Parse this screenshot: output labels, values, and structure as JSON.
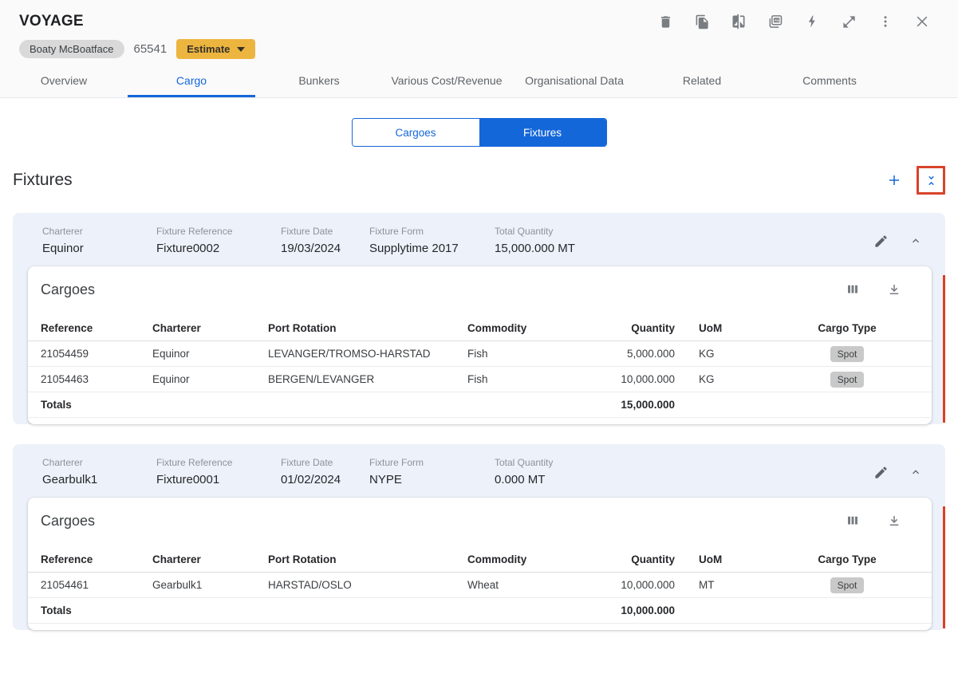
{
  "header": {
    "title": "VOYAGE",
    "vessel_name": "Boaty McBoatface",
    "voyage_number": "65541",
    "estimate_label": "Estimate",
    "tabs": [
      {
        "label": "Overview"
      },
      {
        "label": "Cargo"
      },
      {
        "label": "Bunkers"
      },
      {
        "label": "Various Cost/Revenue"
      },
      {
        "label": "Organisational Data"
      },
      {
        "label": "Related"
      },
      {
        "label": "Comments"
      }
    ],
    "active_tab": "Cargo"
  },
  "view_toggle": {
    "cargoes_label": "Cargoes",
    "fixtures_label": "Fixtures",
    "selected": "Fixtures"
  },
  "fixtures_section": {
    "title": "Fixtures",
    "cards": [
      {
        "fields": [
          {
            "label": "Charterer",
            "value": "Equinor"
          },
          {
            "label": "Fixture Reference",
            "value": "Fixture0002"
          },
          {
            "label": "Fixture Date",
            "value": "19/03/2024"
          },
          {
            "label": "Fixture Form",
            "value": "Supplytime 2017"
          },
          {
            "label": "Total Quantity",
            "value": "15,000.000 MT"
          }
        ],
        "cargoes": {
          "title": "Cargoes",
          "columns": {
            "reference": "Reference",
            "charterer": "Charterer",
            "port_rotation": "Port Rotation",
            "commodity": "Commodity",
            "quantity": "Quantity",
            "uom": "UoM",
            "cargo_type": "Cargo Type"
          },
          "rows": [
            {
              "reference": "21054459",
              "charterer": "Equinor",
              "port_rotation": "LEVANGER/TROMSO-HARSTAD",
              "commodity": "Fish",
              "quantity": "5,000.000",
              "uom": "KG",
              "cargo_type": "Spot"
            },
            {
              "reference": "21054463",
              "charterer": "Equinor",
              "port_rotation": "BERGEN/LEVANGER",
              "commodity": "Fish",
              "quantity": "10,000.000",
              "uom": "KG",
              "cargo_type": "Spot"
            }
          ],
          "totals_label": "Totals",
          "total_quantity": "15,000.000"
        }
      },
      {
        "fields": [
          {
            "label": "Charterer",
            "value": "Gearbulk1"
          },
          {
            "label": "Fixture Reference",
            "value": "Fixture0001"
          },
          {
            "label": "Fixture Date",
            "value": "01/02/2024"
          },
          {
            "label": "Fixture Form",
            "value": "NYPE"
          },
          {
            "label": "Total Quantity",
            "value": "0.000 MT"
          }
        ],
        "cargoes": {
          "title": "Cargoes",
          "columns": {
            "reference": "Reference",
            "charterer": "Charterer",
            "port_rotation": "Port Rotation",
            "commodity": "Commodity",
            "quantity": "Quantity",
            "uom": "UoM",
            "cargo_type": "Cargo Type"
          },
          "rows": [
            {
              "reference": "21054461",
              "charterer": "Gearbulk1",
              "port_rotation": "HARSTAD/OSLO",
              "commodity": "Wheat",
              "quantity": "10,000.000",
              "uom": "MT",
              "cargo_type": "Spot"
            }
          ],
          "totals_label": "Totals",
          "total_quantity": "10,000.000"
        }
      }
    ]
  },
  "colors": {
    "accent_blue": "#1467d9",
    "estimate_amber": "#ecb53f",
    "highlight_red": "#d8432a",
    "card_background": "#edf1f9"
  }
}
